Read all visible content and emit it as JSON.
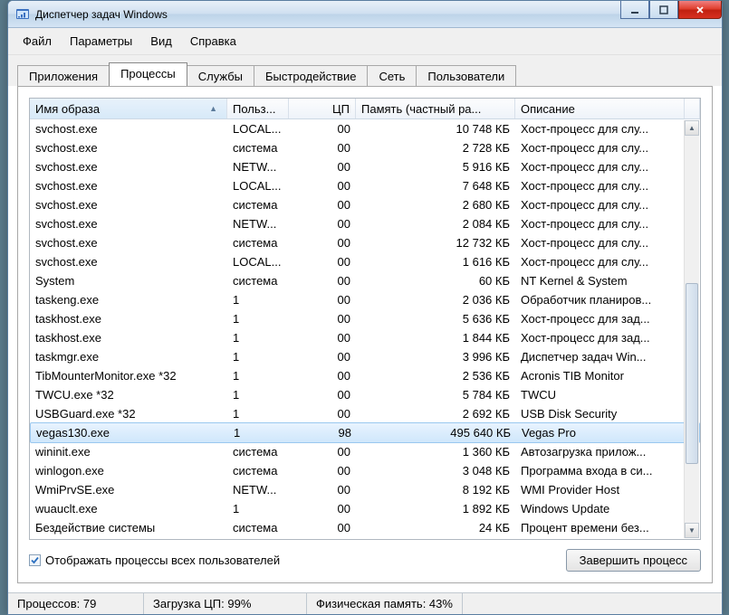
{
  "window": {
    "title": "Диспетчер задач Windows"
  },
  "menu": {
    "file": "Файл",
    "options": "Параметры",
    "view": "Вид",
    "help": "Справка"
  },
  "tabs": {
    "applications": "Приложения",
    "processes": "Процессы",
    "services": "Службы",
    "performance": "Быстродействие",
    "networking": "Сеть",
    "users": "Пользователи"
  },
  "columns": {
    "image": "Имя образа",
    "user": "Польз...",
    "cpu": "ЦП",
    "memory": "Память (частный ра...",
    "description": "Описание"
  },
  "rows": [
    {
      "name": "svchost.exe",
      "user": "LOCAL...",
      "cpu": "00",
      "mem": "10 748 КБ",
      "desc": "Хост-процесс для слу..."
    },
    {
      "name": "svchost.exe",
      "user": "система",
      "cpu": "00",
      "mem": "2 728 КБ",
      "desc": "Хост-процесс для слу..."
    },
    {
      "name": "svchost.exe",
      "user": "NETW...",
      "cpu": "00",
      "mem": "5 916 КБ",
      "desc": "Хост-процесс для слу..."
    },
    {
      "name": "svchost.exe",
      "user": "LOCAL...",
      "cpu": "00",
      "mem": "7 648 КБ",
      "desc": "Хост-процесс для слу..."
    },
    {
      "name": "svchost.exe",
      "user": "система",
      "cpu": "00",
      "mem": "2 680 КБ",
      "desc": "Хост-процесс для слу..."
    },
    {
      "name": "svchost.exe",
      "user": "NETW...",
      "cpu": "00",
      "mem": "2 084 КБ",
      "desc": "Хост-процесс для слу..."
    },
    {
      "name": "svchost.exe",
      "user": "система",
      "cpu": "00",
      "mem": "12 732 КБ",
      "desc": "Хост-процесс для слу..."
    },
    {
      "name": "svchost.exe",
      "user": "LOCAL...",
      "cpu": "00",
      "mem": "1 616 КБ",
      "desc": "Хост-процесс для слу..."
    },
    {
      "name": "System",
      "user": "система",
      "cpu": "00",
      "mem": "60 КБ",
      "desc": "NT Kernel & System"
    },
    {
      "name": "taskeng.exe",
      "user": "1",
      "cpu": "00",
      "mem": "2 036 КБ",
      "desc": "Обработчик планиров..."
    },
    {
      "name": "taskhost.exe",
      "user": "1",
      "cpu": "00",
      "mem": "5 636 КБ",
      "desc": "Хост-процесс для зад..."
    },
    {
      "name": "taskhost.exe",
      "user": "1",
      "cpu": "00",
      "mem": "1 844 КБ",
      "desc": "Хост-процесс для зад..."
    },
    {
      "name": "taskmgr.exe",
      "user": "1",
      "cpu": "00",
      "mem": "3 996 КБ",
      "desc": "Диспетчер задач Win..."
    },
    {
      "name": "TibMounterMonitor.exe *32",
      "user": "1",
      "cpu": "00",
      "mem": "2 536 КБ",
      "desc": "Acronis TIB Monitor"
    },
    {
      "name": "TWCU.exe *32",
      "user": "1",
      "cpu": "00",
      "mem": "5 784 КБ",
      "desc": "TWCU"
    },
    {
      "name": "USBGuard.exe *32",
      "user": "1",
      "cpu": "00",
      "mem": "2 692 КБ",
      "desc": "USB Disk Security"
    },
    {
      "name": "vegas130.exe",
      "user": "1",
      "cpu": "98",
      "mem": "495 640 КБ",
      "desc": "Vegas Pro",
      "selected": true
    },
    {
      "name": "wininit.exe",
      "user": "система",
      "cpu": "00",
      "mem": "1 360 КБ",
      "desc": "Автозагрузка прилож..."
    },
    {
      "name": "winlogon.exe",
      "user": "система",
      "cpu": "00",
      "mem": "3 048 КБ",
      "desc": "Программа входа в си..."
    },
    {
      "name": "WmiPrvSE.exe",
      "user": "NETW...",
      "cpu": "00",
      "mem": "8 192 КБ",
      "desc": "WMI Provider Host"
    },
    {
      "name": "wuauclt.exe",
      "user": "1",
      "cpu": "00",
      "mem": "1 892 КБ",
      "desc": "Windows Update"
    },
    {
      "name": "Бездействие системы",
      "user": "система",
      "cpu": "00",
      "mem": "24 КБ",
      "desc": "Процент времени без..."
    }
  ],
  "checkbox": {
    "label": "Отображать процессы всех пользователей"
  },
  "buttons": {
    "end_process": "Завершить процесс"
  },
  "status": {
    "processes": "Процессов: 79",
    "cpu": "Загрузка ЦП: 99%",
    "memory": "Физическая память: 43%"
  }
}
